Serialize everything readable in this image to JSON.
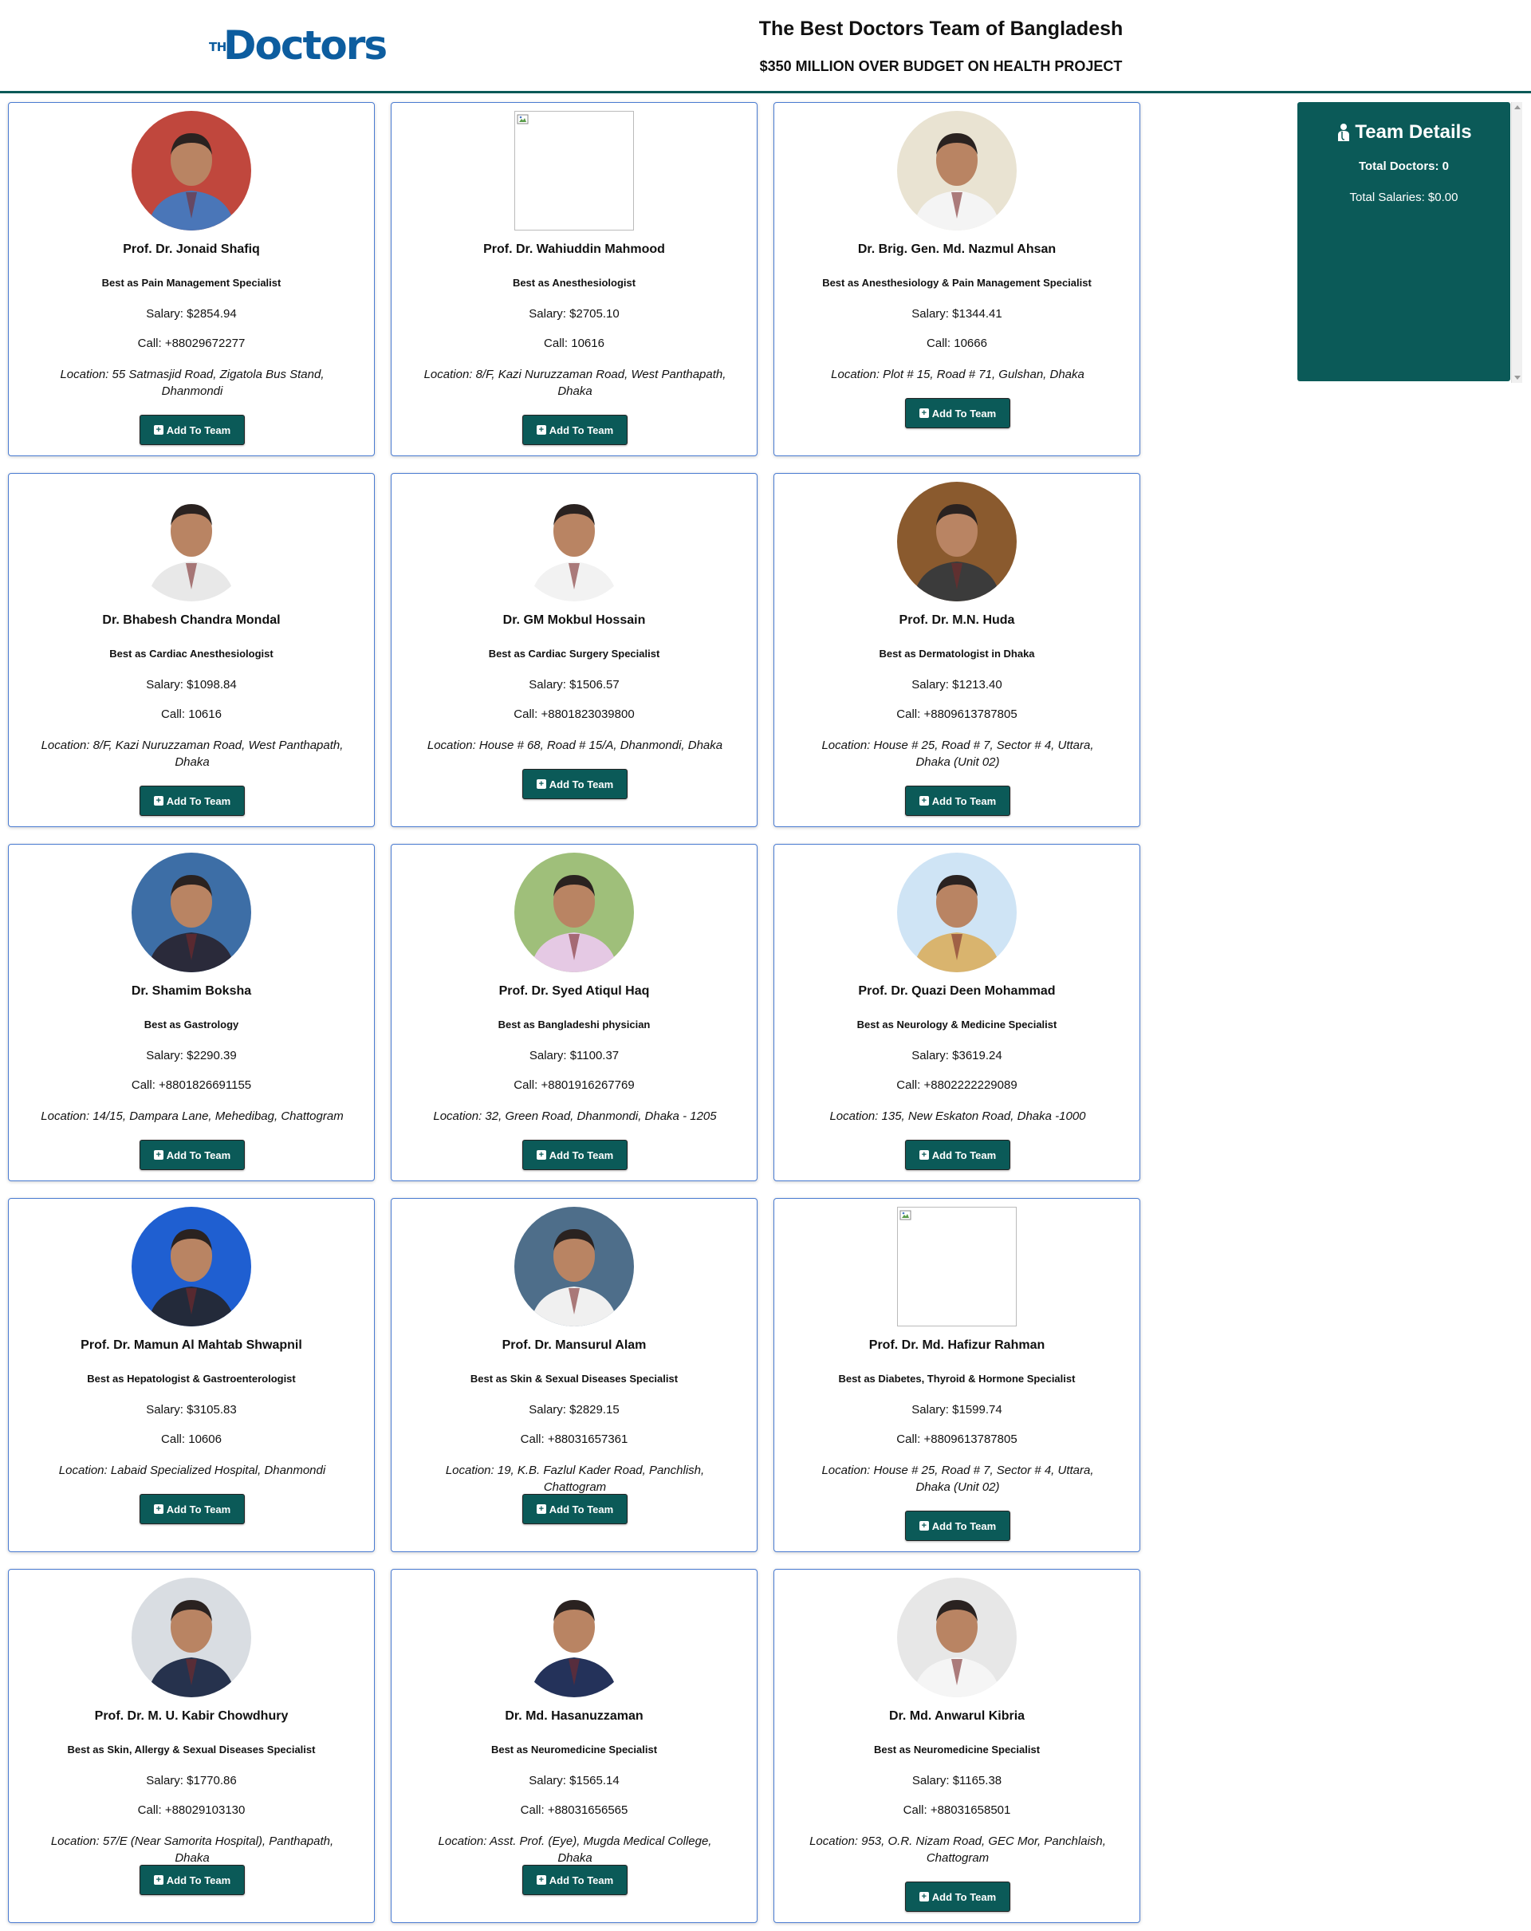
{
  "header": {
    "logo_small": "THE",
    "logo_word": "Doctors",
    "title": "The Best Doctors Team of Bangladesh",
    "subtitle": "$350 MILLION OVER BUDGET ON HEALTH PROJECT"
  },
  "team": {
    "title": "Team Details",
    "total_doctors": "Total Doctors: 0",
    "total_salaries": "Total Salaries: $0.00"
  },
  "button_label": "Add To Team",
  "doctors": [
    {
      "name": "Prof. Dr. Jonaid Shafiq",
      "specialty": "Best as Pain Management Specialist",
      "salary": "Salary: $2854.94",
      "call": "Call: +88029672277",
      "location": "Location: 55 Satmasjid Road, Zigatola Bus Stand, Dhanmondi",
      "bg": "#c0473d",
      "shirt": "#4a76b8",
      "photo": "portrait"
    },
    {
      "name": "Prof. Dr. Wahiuddin Mahmood",
      "specialty": "Best as Anesthesiologist",
      "salary": "Salary: $2705.10",
      "call": "Call: 10616",
      "location": "Location: 8/F, Kazi Nuruzzaman Road, West Panthapath, Dhaka",
      "photo": "broken"
    },
    {
      "name": "Dr. Brig. Gen. Md. Nazmul Ahsan",
      "specialty": "Best as Anesthesiology & Pain Management Specialist",
      "salary": "Salary: $1344.41",
      "call": "Call: 10666",
      "location": "Location: Plot # 15, Road # 71, Gulshan, Dhaka",
      "bg": "#e9e3d2",
      "shirt": "#f4f4f4",
      "photo": "portrait"
    },
    {
      "name": "Dr. Bhabesh Chandra Mondal",
      "specialty": "Best as Cardiac Anesthesiologist",
      "salary": "Salary: $1098.84",
      "call": "Call: 10616",
      "location": "Location: 8/F, Kazi Nuruzzaman Road, West Panthapath, Dhaka",
      "bg": "#ffffff",
      "shirt": "#e8e8e8",
      "photo": "portrait"
    },
    {
      "name": "Dr. GM Mokbul Hossain",
      "specialty": "Best as Cardiac Surgery Specialist",
      "salary": "Salary: $1506.57",
      "call": "Call: +8801823039800",
      "location": "Location: House # 68, Road # 15/A, Dhanmondi, Dhaka",
      "bg": "#ffffff",
      "shirt": "#f2f2f2",
      "photo": "portrait"
    },
    {
      "name": "Prof. Dr. M.N. Huda",
      "specialty": "Best as Dermatologist in Dhaka",
      "salary": "Salary: $1213.40",
      "call": "Call: +8809613787805",
      "location": "Location: House # 25, Road # 7, Sector # 4, Uttara, Dhaka (Unit 02)",
      "bg": "#8a5a2e",
      "shirt": "#3b3b3b",
      "photo": "portrait"
    },
    {
      "name": "Dr. Shamim Boksha",
      "specialty": "Best as Gastrology",
      "salary": "Salary: $2290.39",
      "call": "Call: +8801826691155",
      "location": "Location: 14/15, Dampara Lane, Mehedibag, Chattogram",
      "bg": "#3d6ea6",
      "shirt": "#2a2a3a",
      "photo": "portrait"
    },
    {
      "name": "Prof. Dr. Syed Atiqul Haq",
      "specialty": "Best as Bangladeshi physician",
      "salary": "Salary: $1100.37",
      "call": "Call: +8801916267769",
      "location": "Location: 32, Green Road, Dhanmondi, Dhaka - 1205",
      "bg": "#9fbf7a",
      "shirt": "#e5c9e4",
      "photo": "portrait"
    },
    {
      "name": "Prof. Dr. Quazi Deen Mohammad",
      "specialty": "Best as Neurology & Medicine Specialist",
      "salary": "Salary: $3619.24",
      "call": "Call: +8802222229089",
      "location": "Location: 135, New Eskaton Road, Dhaka -1000",
      "bg": "#cfe4f5",
      "shirt": "#d9b46e",
      "photo": "portrait"
    },
    {
      "name": "Prof. Dr. Mamun Al Mahtab Shwapnil",
      "specialty": "Best as Hepatologist & Gastroenterologist",
      "salary": "Salary: $3105.83",
      "call": "Call: 10606",
      "location": "Location: Labaid Specialized Hospital, Dhanmondi",
      "bg": "#1f5fd1",
      "shirt": "#232a3a",
      "photo": "portrait"
    },
    {
      "name": "Prof. Dr. Mansurul Alam",
      "specialty": "Best as Skin & Sexual Diseases Specialist",
      "salary": "Salary: $2829.15",
      "call": "Call: +88031657361",
      "location": "Location: 19, K.B. Fazlul Kader Road, Panchlish, Chattogram",
      "bg": "#4e6e8a",
      "shirt": "#f0f0f0",
      "photo": "portrait"
    },
    {
      "name": "Prof. Dr. Md. Hafizur Rahman",
      "specialty": "Best as Diabetes, Thyroid & Hormone Specialist",
      "salary": "Salary: $1599.74",
      "call": "Call: +8809613787805",
      "location": "Location: House # 25, Road # 7, Sector # 4, Uttara, Dhaka (Unit 02)",
      "photo": "broken"
    },
    {
      "name": "Prof. Dr. M. U. Kabir Chowdhury",
      "specialty": "Best as Skin, Allergy & Sexual Diseases Specialist",
      "salary": "Salary: $1770.86",
      "call": "Call: +88029103130",
      "location": "Location: 57/E (Near Samorita Hospital), Panthapath, Dhaka",
      "bg": "#d9dde2",
      "shirt": "#26324d",
      "photo": "portrait"
    },
    {
      "name": "Dr. Md. Hasanuzzaman",
      "specialty": "Best as Neuromedicine Specialist",
      "salary": "Salary: $1565.14",
      "call": "Call: +88031656565",
      "location": "Location: Asst. Prof. (Eye), Mugda Medical College, Dhaka",
      "bg": "#ffffff",
      "shirt": "#24325a",
      "photo": "portrait"
    },
    {
      "name": "Dr. Md. Anwarul Kibria",
      "specialty": "Best as Neuromedicine Specialist",
      "salary": "Salary: $1165.38",
      "call": "Call: +88031658501",
      "location": "Location: 953, O.R. Nizam Road, GEC Mor, Panchlaish, Chattogram",
      "bg": "#e7e7e7",
      "shirt": "#f5f5f5",
      "photo": "portrait"
    }
  ]
}
